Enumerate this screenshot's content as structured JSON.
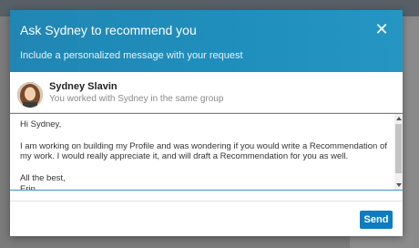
{
  "modal": {
    "title": "Ask Sydney to recommend you",
    "subtitle": "Include a personalized message with your request",
    "close_icon": "close-icon"
  },
  "person": {
    "name": "Sydney Slavin",
    "subtitle": "You worked with Sydney in the same group"
  },
  "message": {
    "text": "Hi Sydney,\n\nI am working on building my Profile and was wondering if you would write a Recommendation of my work. I would really appreciate it, and will draft a Recommendation for you as well.\n\nAll the best,\nErin"
  },
  "footer": {
    "send_label": "Send"
  },
  "colors": {
    "header": "#1f8fbd",
    "send_button": "#0e7cc0",
    "focus_border": "#3d96c6"
  }
}
